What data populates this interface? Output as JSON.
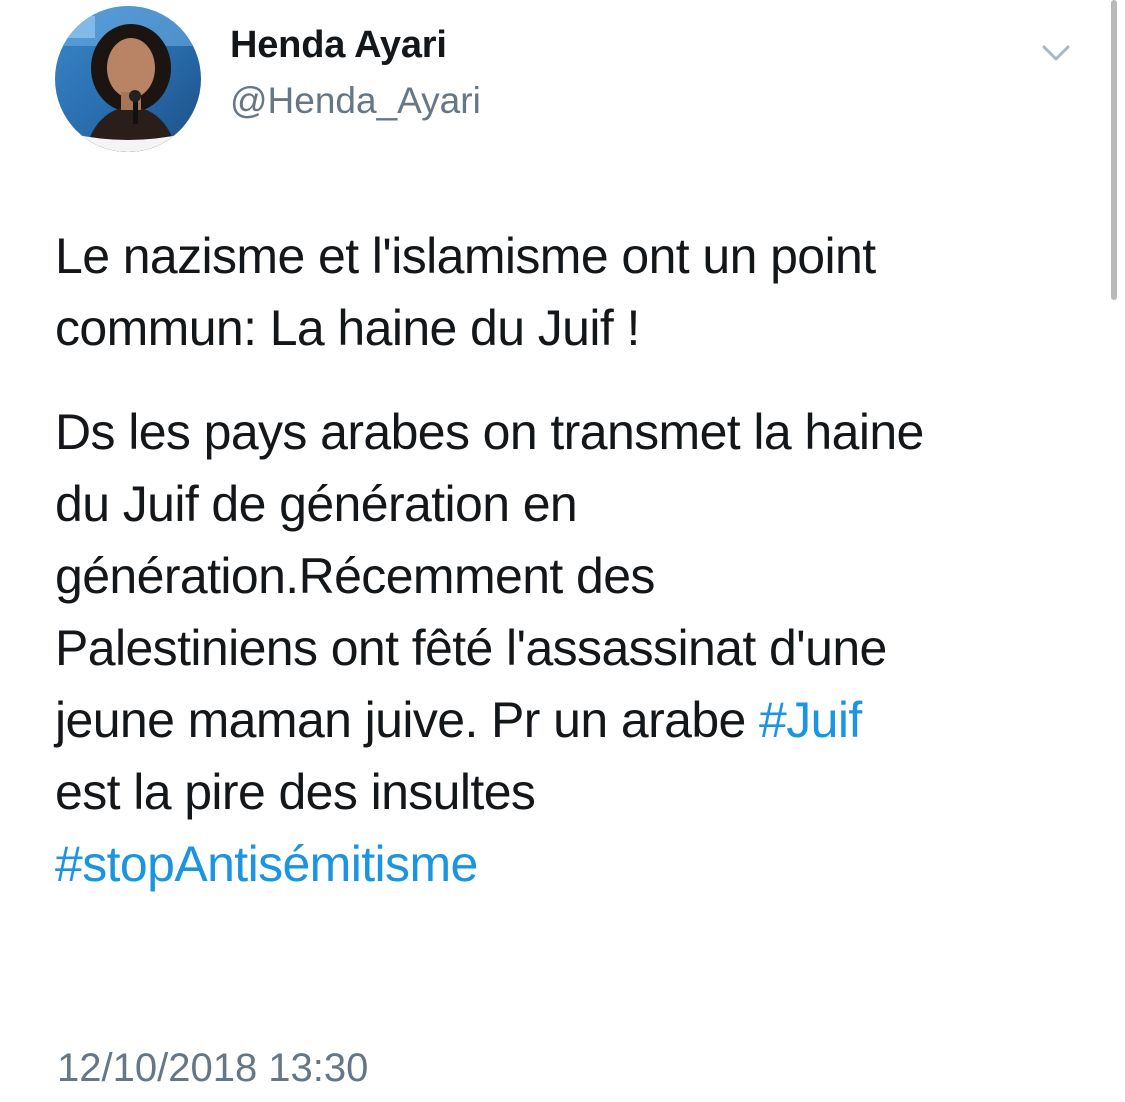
{
  "author": {
    "name": "Henda Ayari",
    "handle": "@Henda_Ayari",
    "avatar_icon": "profile-photo"
  },
  "tweet": {
    "paragraph1": {
      "line1": "Le nazisme et l'islamisme ont un point",
      "line2": "commun: La haine du Juif !"
    },
    "paragraph2": {
      "line1": "Ds les pays arabes on transmet la haine",
      "line2": "du Juif de génération en",
      "line3": "génération.Récemment des",
      "line4": "Palestiniens ont fêté l'assassinat d'une",
      "line5_text": "jeune maman juive. Pr un arabe ",
      "hashtag1": "#Juif",
      "line6": "est la pire des insultes",
      "hashtag2": "#stopAntisémitisme"
    },
    "timestamp": "12/10/2018 13:30"
  },
  "ui": {
    "caret_icon": "chevron-down-icon",
    "hashtag_color": "#1b95e0",
    "secondary_text_color": "#657786"
  }
}
